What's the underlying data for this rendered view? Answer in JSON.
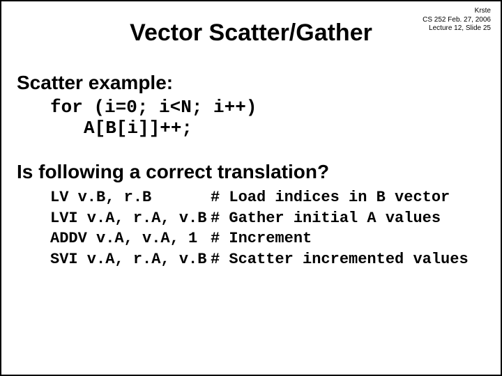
{
  "meta": {
    "author": "Krste",
    "course": "CS 252 Feb. 27, 2006",
    "lecture": "Lecture 12, Slide 25"
  },
  "title": "Vector Scatter/Gather",
  "example": {
    "heading": "Scatter example:",
    "line1": "for (i=0; i<N; i++)",
    "line2": "A[B[i]]++;"
  },
  "question": "Is following a correct translation?",
  "asm": [
    {
      "instr": "LV v.B, r.B",
      "comment": "# Load indices in B vector"
    },
    {
      "instr": "LVI v.A, r.A, v.B",
      "comment": "# Gather initial A values"
    },
    {
      "instr": "ADDV v.A, v.A, 1",
      "comment": "# Increment"
    },
    {
      "instr": "SVI v.A, r.A, v.B",
      "comment": "# Scatter incremented values"
    }
  ]
}
